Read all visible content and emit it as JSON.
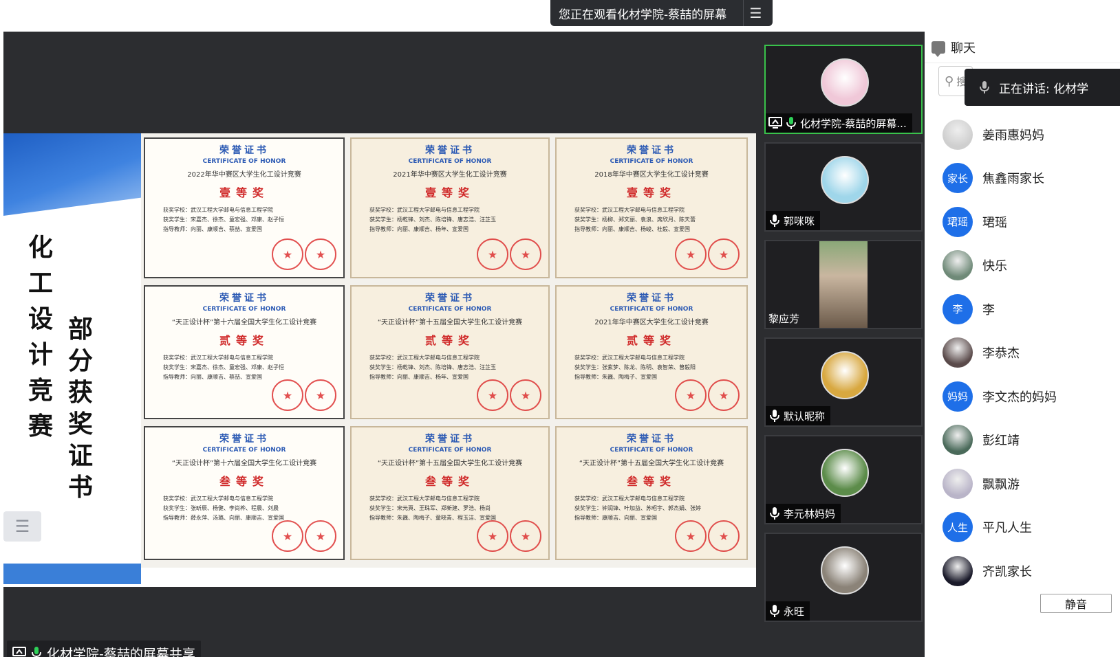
{
  "banner": {
    "text": "您正在观看化材学院-蔡喆的屏幕",
    "menu_icon": "list-icon"
  },
  "slide": {
    "title_vertical_1": "化工设计竞赛",
    "title_vertical_2": "部分获奖证书",
    "menu_icon": "list-icon"
  },
  "certificates": [
    {
      "title": "荣誉证书",
      "en": "CERTIFICATE OF HONOR",
      "contest": "2022年华中赛区大学生化工设计竞赛",
      "level": "壹等奖",
      "school": "获奖学校：武汉工程大学邮电与信息工程学院",
      "students": "获奖学生：宋嘉杰、徐杰、童宏强、邓康、赵子恒",
      "teachers": "指导教师：向丽、康顺吉、蔡喆、宣爱国"
    },
    {
      "title": "荣誉证书",
      "en": "CERTIFICATE OF HONOR",
      "contest": "2021年华中赛区大学生化工设计竞赛",
      "level": "壹等奖",
      "school": "获奖学校：武汉工程大学邮电与信息工程学院",
      "students": "获奖学生：杨乾锋、刘杰、陈培锋、唐志浩、汪芷玉",
      "teachers": "指导教师：向丽、康顺吉、杨年、宣爱国"
    },
    {
      "title": "荣誉证书",
      "en": "CERTIFICATE OF HONOR",
      "contest": "2018年华中赛区大学生化工设计竞赛",
      "level": "壹等奖",
      "school": "获奖学校：武汉工程大学邮电与信息工程学院",
      "students": "获奖学生：杨柳、郑文丽、袁浪、席欣月、陈天蕾",
      "teachers": "指导教师：向丽、康顺吉、杨峻、杜毅、宣爱国"
    },
    {
      "title": "荣誉证书",
      "en": "CERTIFICATE OF HONOR",
      "contest": "“天正设计杯”第十六届全国大学生化工设计竞赛",
      "level": "贰等奖",
      "school": "获奖学校：武汉工程大学邮电与信息工程学院",
      "students": "获奖学生：宋嘉杰、徐杰、童宏强、邓康、赵子恒",
      "teachers": "指导教师：向丽、康顺吉、蔡喆、宣爱国"
    },
    {
      "title": "荣誉证书",
      "en": "CERTIFICATE OF HONOR",
      "contest": "“天正设计杯”第十五届全国大学生化工设计竞赛",
      "level": "贰等奖",
      "school": "获奖学校：武汉工程大学邮电与信息工程学院",
      "students": "获奖学生：杨乾锋、刘杰、陈培锋、唐志浩、汪芷玉",
      "teachers": "指导教师：向丽、康顺吉、杨年、宣爱国"
    },
    {
      "title": "荣誉证书",
      "en": "CERTIFICATE OF HONOR",
      "contest": "2021年华中赛区大学生化工设计竞赛",
      "level": "贰等奖",
      "school": "获奖学校：武汉工程大学邮电与信息工程学院",
      "students": "获奖学生：张紫梦、陈龙、陈明、袁智荣、曾毅阳",
      "teachers": "指导教师：朱巍、陶梅子、宣爱国"
    },
    {
      "title": "荣誉证书",
      "en": "CERTIFICATE OF HONOR",
      "contest": "“天正设计杯”第十六届全国大学生化工设计竞赛",
      "level": "叁等奖",
      "school": "获奖学校：武汉工程大学邮电与信息工程学院",
      "students": "获奖学生：张昕辰、杨健、李尚桦、程晨、刘晨",
      "teachers": "指导教师：薛永萍、汤璐、向丽、康顺吉、宣爱国"
    },
    {
      "title": "荣誉证书",
      "en": "CERTIFICATE OF HONOR",
      "contest": "“天正设计杯”第十五届全国大学生化工设计竞赛",
      "level": "叁等奖",
      "school": "获奖学校：武汉工程大学邮电与信息工程学院",
      "students": "获奖学生：宋元頁、王珠军、郑新建、罗浩、杨尚",
      "teachers": "指导教师：朱巍、陶梅子、童晓青、程玉洁、宣爱国"
    },
    {
      "title": "荣誉证书",
      "en": "CERTIFICATE OF HONOR",
      "contest": "“天正设计杯”第十五届全国大学生化工设计竞赛",
      "level": "叁等奖",
      "school": "获奖学校：武汉工程大学邮电与信息工程学院",
      "students": "获奖学生：钟润锋、叶加益、苏昭宇、郭杰娟、张婷",
      "teachers": "指导教师：康顺吉、向丽、宣爱国"
    }
  ],
  "share_label": "化材学院-蔡喆的屏幕共享",
  "video_tiles": [
    {
      "name": "化材学院-蔡喆的屏幕...",
      "active": true,
      "avatar_color": "#f0c8d8"
    },
    {
      "name": "郭咪咪",
      "active": false,
      "avatar_color": "#9fd6ea"
    },
    {
      "name": "黎应芳",
      "active": false,
      "avatar_color": "#c9b6a0"
    },
    {
      "name": "默认昵称",
      "active": false,
      "avatar_color": "#d8a840"
    },
    {
      "name": "李元林妈妈",
      "active": false,
      "avatar_color": "#5c8c4a"
    },
    {
      "name": "永旺",
      "active": false,
      "avatar_color": "#8b8378"
    }
  ],
  "chat": {
    "title": "聊天",
    "search_placeholder": "搜",
    "speaking": "正在讲话: 化材学",
    "mute_label": "静音",
    "members": [
      {
        "name": "姜雨惠妈妈",
        "avatar_text": "",
        "avatar_color": "#cfcfcf"
      },
      {
        "name": "焦鑫雨家长",
        "avatar_text": "家长",
        "avatar_color": "#1e6fe8"
      },
      {
        "name": "珺瑶",
        "avatar_text": "珺瑶",
        "avatar_color": "#1e6fe8"
      },
      {
        "name": "快乐",
        "avatar_text": "",
        "avatar_color": "#6f8a78"
      },
      {
        "name": "李",
        "avatar_text": "李",
        "avatar_color": "#1e6fe8"
      },
      {
        "name": "李恭杰",
        "avatar_text": "",
        "avatar_color": "#5a4a4a"
      },
      {
        "name": "李文杰的妈妈",
        "avatar_text": "妈妈",
        "avatar_color": "#1e6fe8"
      },
      {
        "name": "彭红靖",
        "avatar_text": "",
        "avatar_color": "#4a6a5a"
      },
      {
        "name": "飘飘游",
        "avatar_text": "",
        "avatar_color": "#b9b4c8"
      },
      {
        "name": "平凡人生",
        "avatar_text": "人生",
        "avatar_color": "#1e6fe8"
      },
      {
        "name": "齐凯家长",
        "avatar_text": "",
        "avatar_color": "#1a1a2a"
      }
    ]
  }
}
